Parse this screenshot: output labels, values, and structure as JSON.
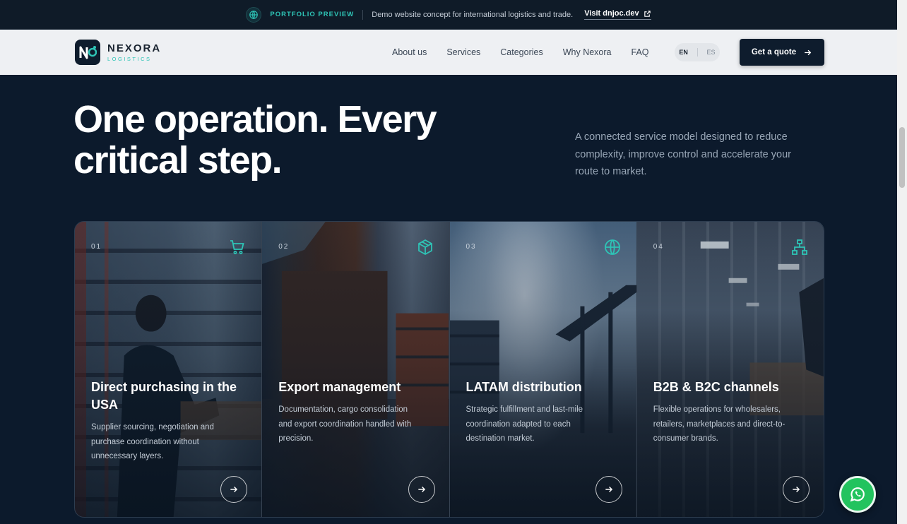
{
  "banner": {
    "badge": "PORTFOLIO PREVIEW",
    "text": "Demo website concept for international logistics and trade.",
    "link": "Visit dnjoc.dev"
  },
  "nav": {
    "brand": "NEXORA",
    "brand_sub": "LOGISTICS",
    "items": [
      {
        "label": "About us"
      },
      {
        "label": "Services"
      },
      {
        "label": "Categories"
      },
      {
        "label": "Why Nexora"
      },
      {
        "label": "FAQ"
      }
    ],
    "lang_active": "EN",
    "lang_other": "ES",
    "cta": "Get a quote"
  },
  "hero": {
    "title": "One operation. Every critical step.",
    "subtitle": "A connected service model designed to reduce complexity, improve control and accelerate your route to market."
  },
  "cards": [
    {
      "num": "01",
      "icon": "cart-icon",
      "title": "Direct purchasing in the USA",
      "desc": "Supplier sourcing, negotiation and purchase coordination without unnecessary layers."
    },
    {
      "num": "02",
      "icon": "box-icon",
      "title": "Export management",
      "desc": "Documentation, cargo consolidation and export coordination handled with precision."
    },
    {
      "num": "03",
      "icon": "globe-icon",
      "title": "LATAM distribution",
      "desc": "Strategic fulfillment and last-mile coordination adapted to each destination market."
    },
    {
      "num": "04",
      "icon": "network-icon",
      "title": "B2B & B2C channels",
      "desc": "Flexible operations for wholesalers, retailers, marketplaces and direct-to-consumer brands."
    }
  ],
  "colors": {
    "accent": "#2ec4b6",
    "navy": "#0e1c2d",
    "whatsapp": "#22c35e"
  }
}
